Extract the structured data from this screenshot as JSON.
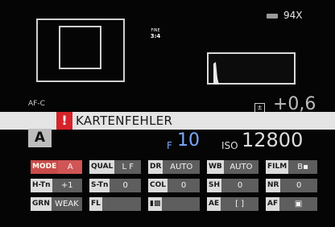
{
  "status": {
    "af_mode": "AF-C",
    "quality_icon": {
      "top": "FINE",
      "bottom": "3:4"
    },
    "shots_remaining": "94X",
    "exposure_comp": "+0,6"
  },
  "error": {
    "badge": "!",
    "message": "KARTENFEHLER"
  },
  "exposure": {
    "mode": "A",
    "aperture_label": "F",
    "aperture_value": "10",
    "iso_label": "ISO",
    "iso_value": "12800"
  },
  "settings": {
    "mode": {
      "label": "MODE",
      "value": "A"
    },
    "qual": {
      "label": "QUAL",
      "value": "L  F"
    },
    "dr": {
      "label": "DR",
      "value": "AUTO"
    },
    "wb": {
      "label": "WB",
      "value": "AUTO"
    },
    "film": {
      "label": "FILM",
      "value": "B▪"
    },
    "htn": {
      "label": "H-Tn",
      "value": "+1"
    },
    "stn": {
      "label": "S-Tn",
      "value": "0"
    },
    "col": {
      "label": "COL",
      "value": "0"
    },
    "sh": {
      "label": "SH",
      "value": "0"
    },
    "nr": {
      "label": "NR",
      "value": "0"
    },
    "grn": {
      "label": "GRN",
      "value": "WEAK"
    },
    "fl": {
      "label": "FL",
      "value": ""
    },
    "is": {
      "label": "▮▩",
      "value": ""
    },
    "ae": {
      "label": "AE",
      "value": "[ ]"
    },
    "af": {
      "label": "AF",
      "value": "▣"
    }
  },
  "colors": {
    "error_red": "#d6232a",
    "aperture_blue": "#7aa9ff",
    "banner_grey": "#e4e4e4"
  }
}
